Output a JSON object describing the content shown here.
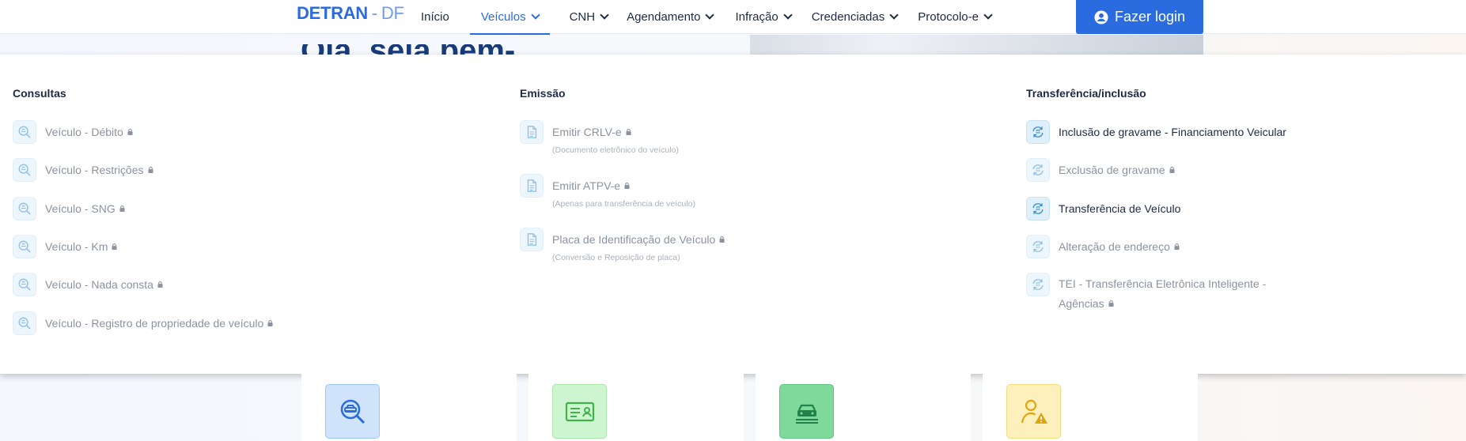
{
  "header": {
    "logo_main": "DETRAN",
    "logo_sep": "-",
    "logo_uf": "DF",
    "nav": [
      {
        "label": "Início",
        "dropdown": false,
        "active": false
      },
      {
        "label": "Veículos",
        "dropdown": true,
        "active": true
      },
      {
        "label": "CNH",
        "dropdown": true,
        "active": false
      },
      {
        "label": "Agendamento",
        "dropdown": true,
        "active": false
      },
      {
        "label": "Infração",
        "dropdown": true,
        "active": false
      },
      {
        "label": "Credenciadas",
        "dropdown": true,
        "active": false
      },
      {
        "label": "Protocolo-e",
        "dropdown": true,
        "active": false
      }
    ],
    "login_label": "Fazer login",
    "login_icon": "user-circle-icon"
  },
  "background": {
    "title": "Olá, seja bem-vindo"
  },
  "menu": {
    "consultas": {
      "title": "Consultas",
      "items": [
        {
          "label": "Veículo - Débito",
          "locked": true,
          "icon": "search-car-icon"
        },
        {
          "label": "Veículo - Restrições",
          "locked": true,
          "icon": "search-car-icon"
        },
        {
          "label": "Veículo - SNG",
          "locked": true,
          "icon": "search-car-icon"
        },
        {
          "label": "Veículo - Km",
          "locked": true,
          "icon": "search-car-icon"
        },
        {
          "label": "Veículo - Nada consta",
          "locked": true,
          "icon": "search-car-icon"
        },
        {
          "label": "Veículo - Registro de propriedade de veículo",
          "locked": true,
          "icon": "search-car-icon"
        }
      ]
    },
    "emissao": {
      "title": "Emissão",
      "items": [
        {
          "label": "Emitir CRLV-e",
          "sub": "(Documento eletrônico do veículo)",
          "locked": true,
          "icon": "document-icon"
        },
        {
          "label": "Emitir ATPV-e",
          "sub": "(Apenas para transferência de veículo)",
          "locked": true,
          "icon": "document-icon"
        },
        {
          "label": "Placa de Identificação de Veículo",
          "sub": "(Conversão e Reposição de placa)",
          "locked": true,
          "icon": "document-icon"
        }
      ]
    },
    "transferencia": {
      "title": "Transferência/inclusão",
      "items": [
        {
          "label": "Inclusão de gravame - Financiamento Veicular",
          "locked": false,
          "icon": "transfer-car-icon"
        },
        {
          "label": "Exclusão de gravame",
          "locked": true,
          "icon": "transfer-car-icon"
        },
        {
          "label": "Transferência de Veículo",
          "locked": false,
          "icon": "transfer-car-icon"
        },
        {
          "label": "Alteração de endereço",
          "locked": true,
          "icon": "transfer-car-icon"
        },
        {
          "label": "TEI - Transferência Eletrônica Inteligente - Agências",
          "locked": true,
          "icon": "transfer-car-icon"
        }
      ]
    }
  },
  "cards": [
    {
      "icon": "search-car-icon",
      "bg": "#cfe4fb",
      "border": "#9cc7f3",
      "color": "#2a6be0"
    },
    {
      "icon": "id-card-icon",
      "bg": "#cdf5cf",
      "border": "#a8e6ab",
      "color": "#43b14b"
    },
    {
      "icon": "car-document-icon",
      "bg": "#7fd99a",
      "border": "#5fc47f",
      "color": "#22804a"
    },
    {
      "icon": "user-warning-icon",
      "bg": "#fdf0bd",
      "border": "#f3da7f",
      "color": "#e2a310"
    }
  ],
  "colors": {
    "brand": "#2a6be0",
    "text": "#1c2a44",
    "muted": "#8a93a1",
    "icon_bg": "#dff0fb"
  }
}
